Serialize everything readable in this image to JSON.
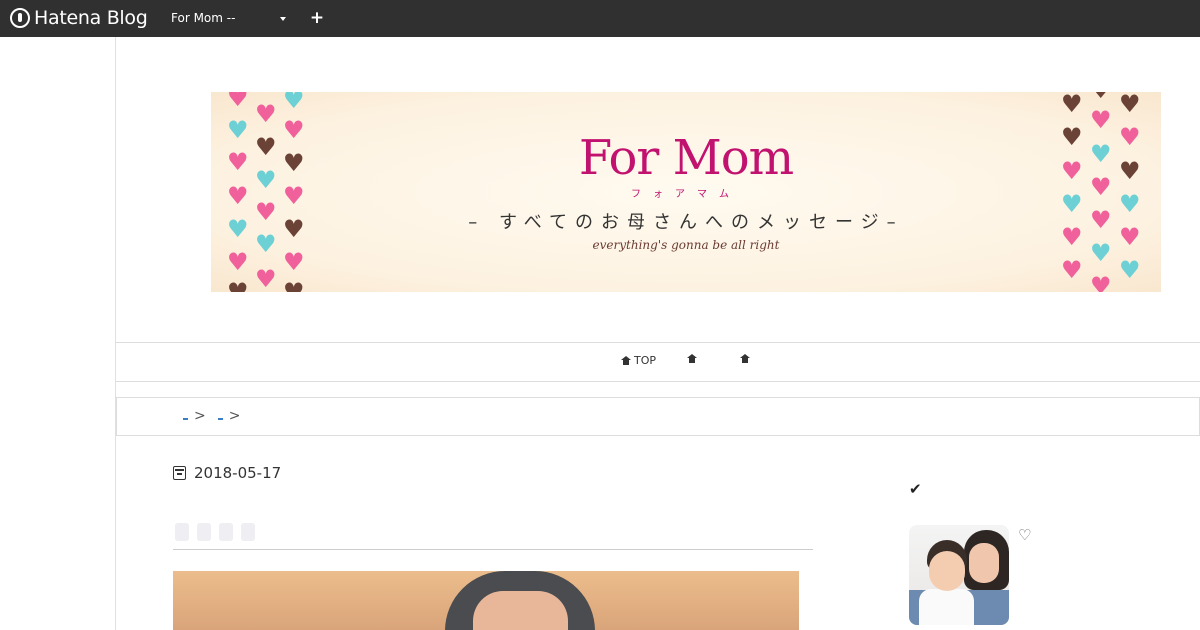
{
  "topbar": {
    "logo_text": "Hatena Blog",
    "blog_selector": "For Mom --",
    "add_symbol": "+"
  },
  "banner": {
    "title": "For Mom",
    "kana": "フォアマム",
    "subtitle": "– すべてのお母さんへのメッセージ–",
    "tagline": "everything's gonna be all right"
  },
  "nav": {
    "items": [
      {
        "label": "TOP",
        "icon": "home-icon"
      },
      {
        "label": "",
        "icon": "home-icon"
      },
      {
        "label": "",
        "icon": "home-icon"
      }
    ]
  },
  "breadcrumb": {
    "separator": ">"
  },
  "article": {
    "date": "2018-05-17"
  },
  "sidebar": {
    "check_symbol": "✔",
    "heart_symbol": "♡"
  },
  "colors": {
    "topbar_bg": "#303030",
    "brand_pink": "#c2126f",
    "heart_pink": "#f0609a",
    "heart_teal": "#6dd0d4",
    "heart_brown": "#6b4236",
    "banner_bg": "#fdf2e1"
  }
}
